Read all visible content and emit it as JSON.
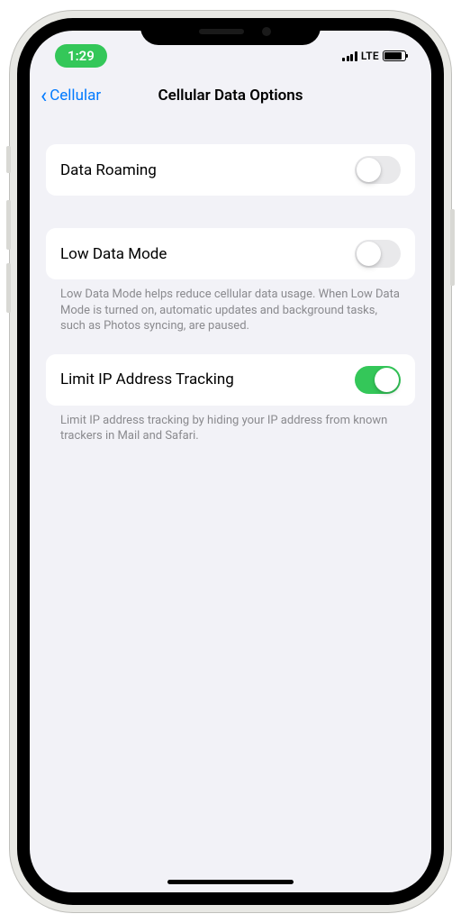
{
  "status": {
    "time": "1:29",
    "network_type": "LTE"
  },
  "nav": {
    "back_label": "Cellular",
    "title": "Cellular Data Options"
  },
  "settings": {
    "data_roaming": {
      "label": "Data Roaming",
      "enabled": false
    },
    "low_data_mode": {
      "label": "Low Data Mode",
      "enabled": false,
      "footer": "Low Data Mode helps reduce cellular data usage. When Low Data Mode is turned on, automatic updates and background tasks, such as Photos syncing, are paused."
    },
    "limit_ip_tracking": {
      "label": "Limit IP Address Tracking",
      "enabled": true,
      "footer": "Limit IP address tracking by hiding your IP address from known trackers in Mail and Safari."
    }
  }
}
